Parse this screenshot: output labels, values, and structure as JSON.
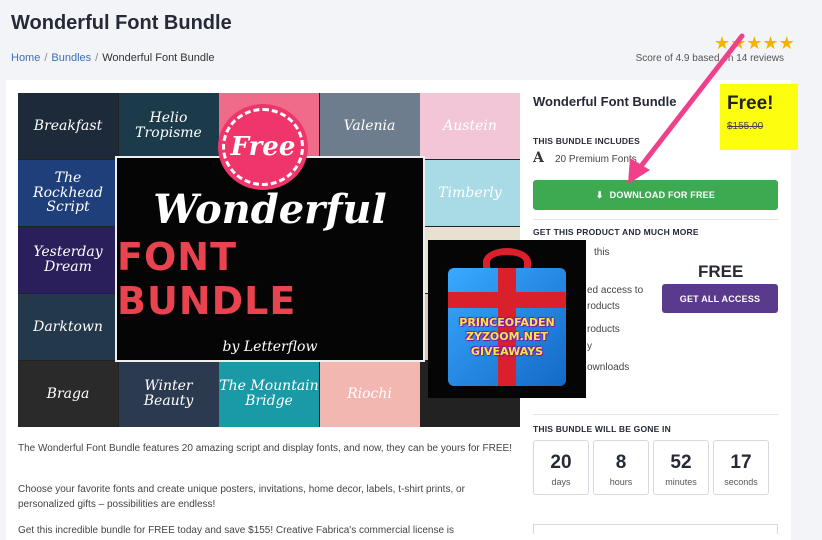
{
  "page": {
    "title": "Wonderful Font Bundle"
  },
  "breadcrumb": {
    "home": "Home",
    "bundles": "Bundles",
    "current": "Wonderful Font Bundle"
  },
  "rating": {
    "stars": 5,
    "score_text": "Score of 4.9 based on 14 reviews"
  },
  "gallery": {
    "tiles": [
      {
        "label": "Breakfast",
        "bg": "#1d2a3a"
      },
      {
        "label": "Helio Tropisme",
        "bg": "#1c3b4a"
      },
      {
        "label": "",
        "bg": "#f06a8a"
      },
      {
        "label": "Valenia",
        "bg": "#6d7d8e"
      },
      {
        "label": "Austein",
        "bg": "#f2c6d6"
      },
      {
        "label": "The Rockhead Script",
        "bg": "#1f3f7a"
      },
      {
        "label": "Timberly",
        "bg": "#a8dbe6"
      },
      {
        "label": "Yesterday Dream",
        "bg": "#2a1f5a"
      },
      {
        "label": "",
        "bg": "#e8e0d0"
      },
      {
        "label": "Darktown",
        "bg": "#23384a"
      },
      {
        "label": "",
        "bg": "#d8c8b8"
      },
      {
        "label": "Braga",
        "bg": "#2a2a2a"
      },
      {
        "label": "Winter Beauty",
        "bg": "#2b3a4e"
      },
      {
        "label": "The Mountain Bridge",
        "bg": "#1a9aa6"
      },
      {
        "label": "Riochi",
        "bg": "#f1b7b0"
      }
    ],
    "free_badge": "Free",
    "art_title_1": "Wonderful",
    "art_title_2": "FONT BUNDLE",
    "art_by": "by Letterflow",
    "giveaway_text": "PRINCEOFADEN ZYZOOM.NET GIVEAWAYS"
  },
  "description": {
    "p1": "The Wonderful Font Bundle features 20 amazing script and display fonts, and now, they can be yours for FREE!",
    "p2": "Choose your favorite fonts and create unique posters, invitations, home decor, labels, t-shirt prints, or personalized gifts – possibilities are endless!",
    "p3": "Get this incredible bundle for FREE today and save $155! Creative Fabrica's commercial license is"
  },
  "sidebar": {
    "title": "Wonderful Font Bundle",
    "free_label": "Free!",
    "old_price": "$155.00",
    "includes_label": "THIS BUNDLE INCLUDES",
    "fonts_count": "20 Premium Fonts",
    "download_label": "DOWNLOAD FOR FREE",
    "more_label": "GET THIS PRODUCT AND MUCH MORE",
    "features": [
      "this",
      "ed access to",
      "roducts",
      "roducts",
      "y",
      "ownloads"
    ],
    "access_price": "FREE",
    "access_label": "GET ALL ACCESS",
    "gone_label": "THIS BUNDLE WILL BE GONE IN",
    "countdown": [
      {
        "value": "20",
        "unit": "days"
      },
      {
        "value": "8",
        "unit": "hours"
      },
      {
        "value": "52",
        "unit": "minutes"
      },
      {
        "value": "17",
        "unit": "seconds"
      }
    ]
  },
  "colors": {
    "download": "#3daa52",
    "access": "#5a3a8c",
    "highlight": "#fdfd10",
    "arrow": "#f0408a"
  }
}
